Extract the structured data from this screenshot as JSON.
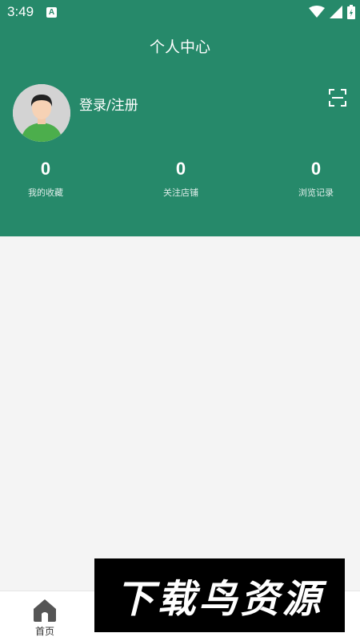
{
  "status": {
    "time": "3:49",
    "notif_letter": "A"
  },
  "header": {
    "title": "个人中心"
  },
  "profile": {
    "login_label": "登录/注册"
  },
  "stats": [
    {
      "value": "0",
      "label": "我的收藏"
    },
    {
      "value": "0",
      "label": "关注店铺"
    },
    {
      "value": "0",
      "label": "浏览记录"
    }
  ],
  "nav": [
    {
      "label": "首页",
      "icon": "home-icon"
    },
    {
      "label": "",
      "icon": ""
    },
    {
      "label": "",
      "icon": ""
    },
    {
      "label": "",
      "icon": ""
    }
  ],
  "watermark": {
    "text": "下载鸟资源"
  },
  "colors": {
    "primary": "#26896a",
    "background": "#f4f4f4"
  }
}
